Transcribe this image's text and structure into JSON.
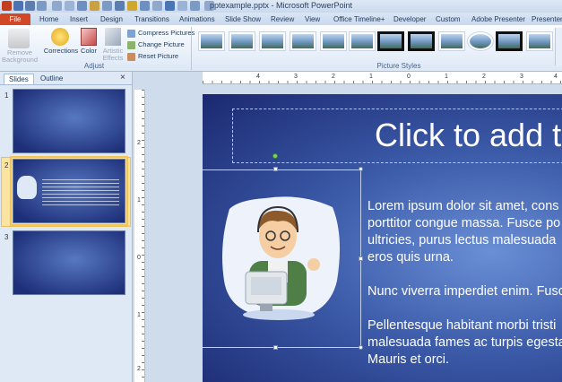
{
  "window": {
    "title": "pptexample.pptx - Microsoft PowerPoint"
  },
  "tabs": [
    {
      "label": "File"
    },
    {
      "label": "Home"
    },
    {
      "label": "Insert"
    },
    {
      "label": "Design"
    },
    {
      "label": "Transitions"
    },
    {
      "label": "Animations"
    },
    {
      "label": "Slide Show"
    },
    {
      "label": "Review"
    },
    {
      "label": "View"
    },
    {
      "label": "Office Timeline+"
    },
    {
      "label": "Developer"
    },
    {
      "label": "Custom"
    },
    {
      "label": "Adobe Presenter"
    },
    {
      "label": "PresenterMe"
    }
  ],
  "ribbon": {
    "remove_background": "Remove Background",
    "corrections": "Corrections",
    "color": "Color",
    "artistic_effects": "Artistic Effects",
    "compress_pictures": "Compress Pictures",
    "change_picture": "Change Picture",
    "reset_picture": "Reset Picture",
    "adjust_group": "Adjust",
    "picture_styles_group": "Picture Styles"
  },
  "pane": {
    "tab_slides": "Slides",
    "tab_outline": "Outline",
    "close": "×",
    "slide_numbers": [
      "1",
      "2",
      "3"
    ]
  },
  "ruler": {
    "h_numbers": [
      "4",
      "3",
      "2",
      "1",
      "0",
      "1",
      "2",
      "3",
      "4"
    ],
    "v_numbers": [
      "2",
      "1",
      "0",
      "1",
      "2"
    ]
  },
  "slide": {
    "title": "Click to add ti",
    "body": [
      "Lorem ipsum dolor sit amet, cons",
      "porttitor congue massa. Fusce po",
      "ultricies, purus lectus malesuada",
      "eros quis urna.",
      "Nunc viverra imperdiet enim. Fusc",
      "Pellentesque habitant morbi tristi",
      "malesuada fames ac turpis egesta",
      "Mauris et orci."
    ]
  },
  "colors": {
    "file_tab": "#d24726",
    "slide_bg": "#2a3f8f",
    "selection_thumb": "#fbe3a2"
  }
}
